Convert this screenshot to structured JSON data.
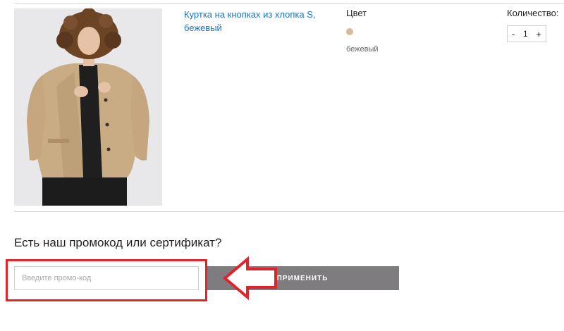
{
  "cart_item": {
    "product_name": "Куртка на кнопках из хлопка S, бежевый",
    "color_label": "Цвет",
    "color_value": "бежевый",
    "color_swatch_hex": "#d8bb9f",
    "quantity_label": "Количество:",
    "quantity_minus": "-",
    "quantity_value": "1",
    "quantity_plus": "+"
  },
  "promo": {
    "title": "Есть наш промокод или сертификат?",
    "input_placeholder": "Введите промо-код",
    "input_value": "",
    "apply_label": "ПРИМЕНИТЬ"
  },
  "annotation": {
    "highlight_color": "#e0242b"
  },
  "colors": {
    "link": "#1a73c9",
    "apply_button_bg": "#7e7c7f"
  },
  "icons": {
    "product_image": "product-photo-beige-jacket",
    "arrow": "red-left-arrow"
  }
}
